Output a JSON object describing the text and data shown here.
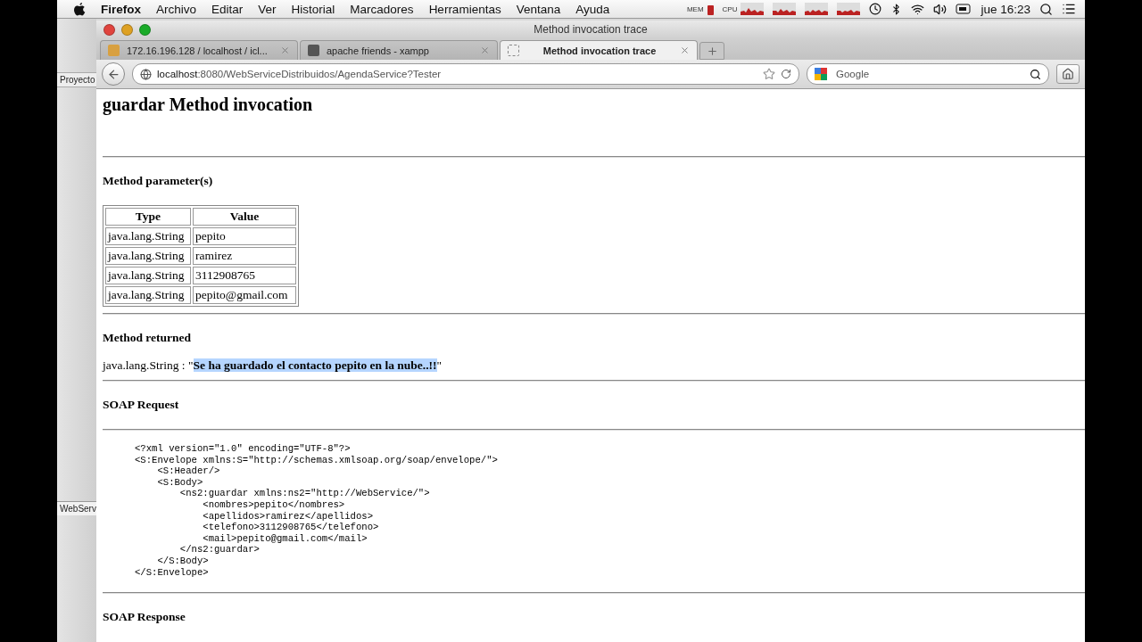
{
  "menu_bar": {
    "app": "Firefox",
    "items": [
      "Archivo",
      "Editar",
      "Ver",
      "Historial",
      "Marcadores",
      "Herramientas",
      "Ventana",
      "Ayuda"
    ],
    "monitor_labels": [
      "MEM",
      "CPU"
    ],
    "clock": "jue 16:23"
  },
  "ide_panel": {
    "tab": "Proyecto",
    "bottom_tab": "WebServ"
  },
  "window": {
    "title": "Method invocation trace"
  },
  "tabs": [
    {
      "label": "172.16.196.128 / localhost / icl...",
      "selected": false
    },
    {
      "label": "apache friends - xampp",
      "selected": false
    },
    {
      "label": "Method invocation trace",
      "selected": true
    }
  ],
  "url": {
    "host": "localhost",
    "rest": ":8080/WebServiceDistribuidos/AgendaService?Tester"
  },
  "search": {
    "placeholder": "Google"
  },
  "page": {
    "heading": "guardar Method invocation",
    "params_title": "Method parameter(s)",
    "columns": [
      "Type",
      "Value"
    ],
    "rows": [
      [
        "java.lang.String",
        "pepito"
      ],
      [
        "java.lang.String",
        "ramirez"
      ],
      [
        "java.lang.String",
        "3112908765"
      ],
      [
        "java.lang.String",
        "pepito@gmail.com"
      ]
    ],
    "returned_title": "Method returned",
    "returned_value": "java.lang.String : \"**Se ha guardado el contacto pepito en la nube..!!**\"",
    "request_title": "SOAP Request",
    "request_lines": [
      "<?xml version=\"1.0\" encoding=\"UTF-8\"?>",
      "<S:Envelope xmlns:S=\"http://schemas.xmlsoap.org/soap/envelope/\">",
      "    <S:Header/>",
      "    <S:Body>",
      "        <ns2:guardar xmlns:ns2=\"http://WebService/\">",
      "            <nombres>pepito</nombres>",
      "            <apellidos>ramirez</apellidos>",
      "            <telefono>3112908765</telefono>",
      "            <mail>pepito@gmail.com</mail>",
      "        </ns2:guardar>",
      "    </S:Body>",
      "</S:Envelope>"
    ],
    "response_title": "SOAP Response"
  }
}
